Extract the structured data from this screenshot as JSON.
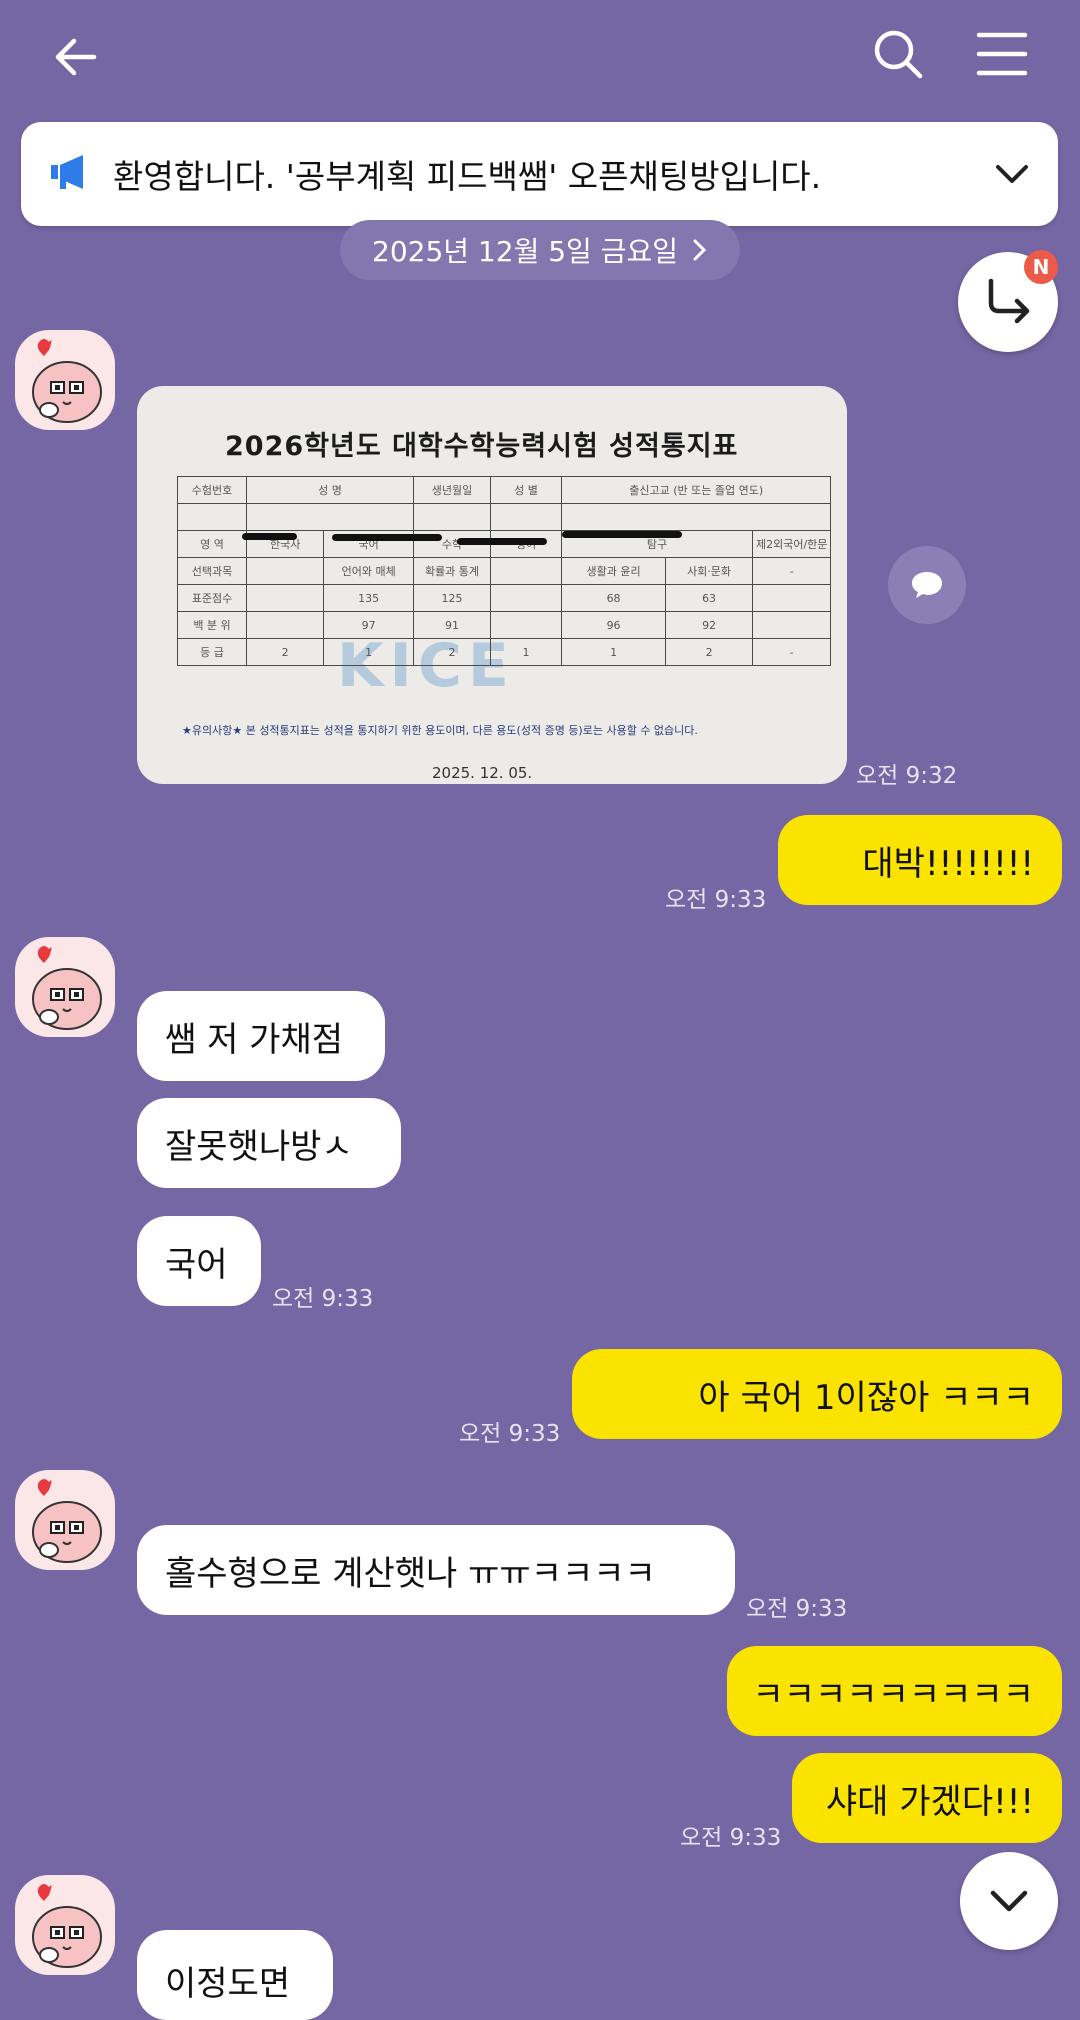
{
  "header": {
    "back_icon": "arrow-left-icon",
    "search_icon": "search-icon",
    "menu_icon": "hamburger-menu-icon"
  },
  "notice": {
    "icon": "megaphone-icon",
    "text": "환영합니다. '공부계획  피드백쌤' 오픈채팅방입니다."
  },
  "date_divider": "2025년 12월 5일 금요일",
  "reply_badge": "N",
  "score_sheet": {
    "title": "2026학년도 대학수학능력시험 성적통지표",
    "header_row": [
      "수험번호",
      "성   명",
      "생년월일",
      "성   별",
      "출신고교 (반 또는 졸업 연도)"
    ],
    "col_headers": [
      "영   역",
      "한국사",
      "국어",
      "수학",
      "영어",
      "탐구",
      "",
      "제2외국어/한문"
    ],
    "row_subject": [
      "선택과목",
      "",
      "언어와 매체",
      "확률과 통계",
      "",
      "생활과 윤리",
      "사회·문화",
      "-"
    ],
    "row_standard": [
      "표준점수",
      "",
      "135",
      "125",
      "",
      "68",
      "63",
      ""
    ],
    "row_percentile": [
      "백 분 위",
      "",
      "97",
      "91",
      "",
      "96",
      "92",
      ""
    ],
    "row_grade": [
      "등   급",
      "2",
      "1",
      "2",
      "1",
      "1",
      "2",
      "-"
    ],
    "note": "★유의사항★  본 성적통지표는 성적을 통지하기 위한 용도이며, 다른 용도(성적 증명 등)로는 사용할 수 없습니다.",
    "watermark": "KICE",
    "date": "2025. 12. 05."
  },
  "messages": {
    "photo_time": "오전 9:32",
    "m1": {
      "text": "대박!!!!!!!!",
      "time": "오전 9:33"
    },
    "m2": {
      "text": "쌤 저 가채점"
    },
    "m3": {
      "text": "잘못햇나방ㅅ"
    },
    "m4": {
      "text": "국어",
      "time": "오전 9:33"
    },
    "m5": {
      "text": "아 국어 1이잖아 ㅋㅋㅋ",
      "time": "오전 9:33"
    },
    "m6": {
      "text": "홀수형으로 계산햇나 ㅠㅠㅋㅋㅋㅋ",
      "time": "오전 9:33"
    },
    "m7": {
      "text": "ㅋㅋㅋㅋㅋㅋㅋㅋㅋ"
    },
    "m8": {
      "text": "샤대 가겠다!!!",
      "time": "오전 9:33"
    },
    "m9": {
      "text": "이정도면"
    }
  },
  "colors": {
    "background": "#7467a4",
    "outgoing_bubble": "#fbe300",
    "incoming_bubble": "#ffffff",
    "badge": "#ee5a4a"
  }
}
